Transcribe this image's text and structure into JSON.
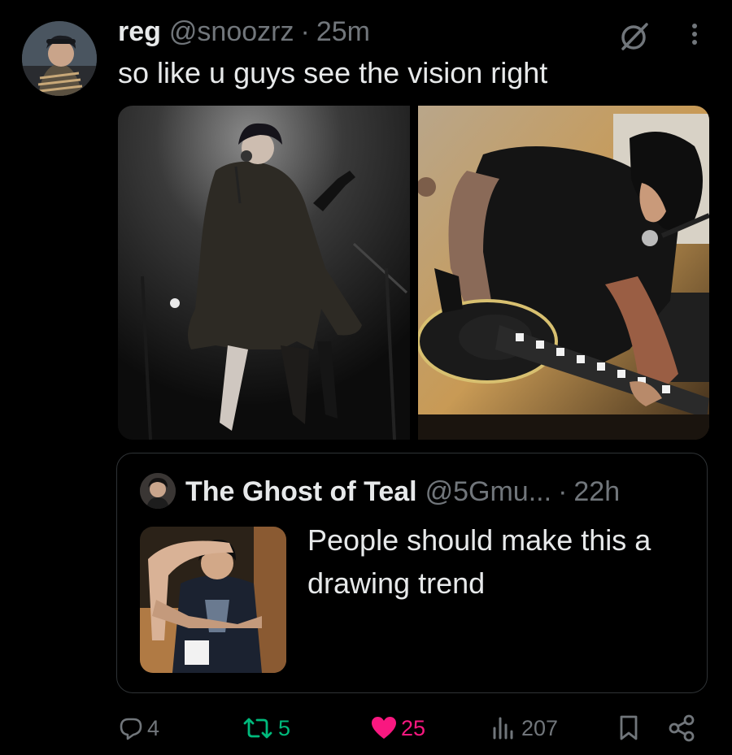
{
  "post": {
    "author_name": "reg",
    "author_handle": "@snoozrz",
    "separator": "·",
    "time": "25m",
    "text": "so like u guys see the vision right"
  },
  "quote": {
    "author_name": "The Ghost of Teal",
    "author_handle": "@5Gmu...",
    "separator": "·",
    "time": "22h",
    "text": "People should make this a drawing trend"
  },
  "actions": {
    "replies": "4",
    "reposts": "5",
    "likes": "25",
    "views": "207"
  },
  "icons": {
    "grok": "grok-icon",
    "more": "more-vertical-icon",
    "reply": "reply-icon",
    "repost": "repost-icon",
    "like": "heart-icon",
    "views": "views-icon",
    "bookmark": "bookmark-icon",
    "share": "share-icon"
  },
  "colors": {
    "background": "#000000",
    "text_primary": "#e7e9ea",
    "text_secondary": "#71767b",
    "repost_active": "#00ba7c",
    "like_active": "#f91880",
    "border": "#2f3336"
  }
}
